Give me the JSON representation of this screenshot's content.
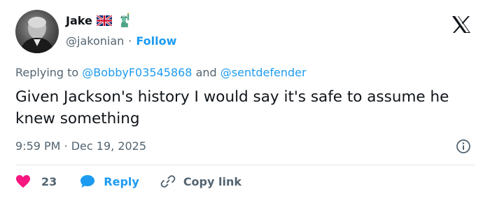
{
  "author": {
    "name": "Jake",
    "handle": "@jakonian",
    "separator": "·",
    "follow_label": "Follow",
    "badges": [
      "uk-flag-icon",
      "statue-of-liberty-icon"
    ]
  },
  "reply_context": {
    "prefix": "Replying to ",
    "mention_1": "@BobbyF03545868",
    "conjunction": " and ",
    "mention_2": "@sentdefender"
  },
  "tweet": {
    "text": "Given Jackson's history I would say it's safe to assume he knew something",
    "time": "9:59 PM",
    "date_separator": " · ",
    "date": "Dec 19, 2025"
  },
  "actions": {
    "like_count": "23",
    "reply_label": "Reply",
    "copy_label": "Copy link"
  },
  "colors": {
    "accent": "#1d9bf0",
    "like": "#f91880",
    "muted": "#536471",
    "text": "#0f1419"
  },
  "icons": {
    "logo": "x-logo-icon",
    "info": "info-icon",
    "like": "heart-icon",
    "reply": "speech-bubble-icon",
    "copy": "link-icon"
  }
}
